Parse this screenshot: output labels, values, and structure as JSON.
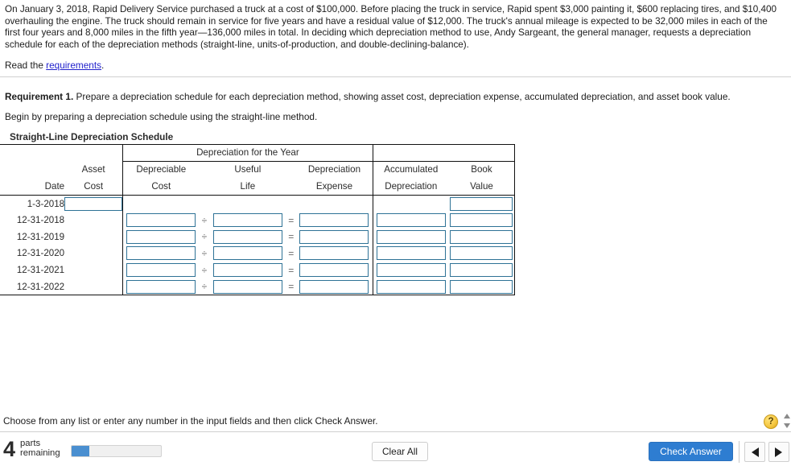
{
  "problem": {
    "statement": "On January 3, 2018, Rapid Delivery Service purchased a truck at a cost of $100,000. Before placing the truck in service, Rapid spent $3,000 painting it, $600 replacing tires, and $10,400 overhauling the engine. The truck should remain in service for five years and have a residual value of $12,000. The truck's annual mileage is expected to be 32,000 miles in each of the first four years and 8,000 miles in the fifth year—136,000 miles in total. In deciding which depreciation method to use, Andy Sargeant, the general manager, requests a depreciation schedule for each of the depreciation methods (straight-line, units-of-production, and double-declining-balance).",
    "read_prefix": "Read the ",
    "read_link": "requirements",
    "read_suffix": ".",
    "requirement_label": "Requirement 1.",
    "requirement_text": " Prepare a depreciation schedule for each depreciation method, showing asset cost, depreciation expense, accumulated depreciation, and asset book value.",
    "begin_text": "Begin by preparing a depreciation schedule using the straight-line method."
  },
  "schedule": {
    "title": "Straight-Line Depreciation Schedule",
    "group_header": "Depreciation for the Year",
    "columns": {
      "date": {
        "line1": "",
        "line2": "Date"
      },
      "asset": {
        "line1": "Asset",
        "line2": "Cost"
      },
      "depreciable": {
        "line1": "Depreciable",
        "line2": "Cost"
      },
      "useful": {
        "line1": "Useful",
        "line2": "Life"
      },
      "expense": {
        "line1": "Depreciation",
        "line2": "Expense"
      },
      "accumulated": {
        "line1": "Accumulated",
        "line2": "Depreciation"
      },
      "book": {
        "line1": "Book",
        "line2": "Value"
      }
    },
    "operators": {
      "divide": "÷",
      "equals": "="
    },
    "rows": [
      {
        "date": "1-3-2018",
        "has_asset_input": true,
        "has_year_inputs": false,
        "has_accum_input": false,
        "has_book_input": true
      },
      {
        "date": "12-31-2018",
        "has_asset_input": false,
        "has_year_inputs": true,
        "has_accum_input": true,
        "has_book_input": true
      },
      {
        "date": "12-31-2019",
        "has_asset_input": false,
        "has_year_inputs": true,
        "has_accum_input": true,
        "has_book_input": true
      },
      {
        "date": "12-31-2020",
        "has_asset_input": false,
        "has_year_inputs": true,
        "has_accum_input": true,
        "has_book_input": true
      },
      {
        "date": "12-31-2021",
        "has_asset_input": false,
        "has_year_inputs": true,
        "has_accum_input": true,
        "has_book_input": true
      },
      {
        "date": "12-31-2022",
        "has_asset_input": false,
        "has_year_inputs": true,
        "has_accum_input": true,
        "has_book_input": true
      }
    ]
  },
  "footer": {
    "instruction": "Choose from any list or enter any number in the input fields and then click Check Answer.",
    "help_glyph": "?",
    "parts_count": "4",
    "parts_label_line1": "parts",
    "parts_label_line2": "remaining",
    "progress_percent": 20,
    "clear_all_label": "Clear All",
    "check_answer_label": "Check Answer"
  },
  "colors": {
    "accent_blue": "#2e7dd1",
    "input_border": "#2e7296",
    "link_blue": "#2222cc",
    "help_yellow": "#f6c944",
    "progress_fill": "#4a8fd0"
  }
}
